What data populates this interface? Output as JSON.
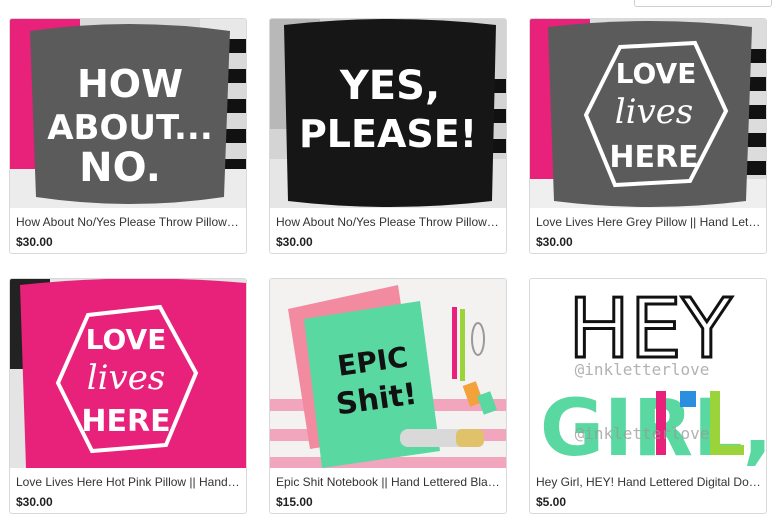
{
  "products": [
    {
      "title": "How About No/Yes Please Throw Pillow || Hand Lettered",
      "price": "$30.00",
      "art_text": [
        "HOW",
        "ABOUT...",
        "NO."
      ]
    },
    {
      "title": "How About No/Yes Please Throw Pillow || Hand Lettered",
      "price": "$30.00",
      "art_text": [
        "YES,",
        "PLEASE!"
      ]
    },
    {
      "title": "Love Lives Here Grey Pillow || Hand Lettered",
      "price": "$30.00",
      "art_text": [
        "LOVE",
        "lives",
        "HERE"
      ]
    },
    {
      "title": "Love Lives Here Hot Pink Pillow || Hand Lettered",
      "price": "$30.00",
      "art_text": [
        "LOVE",
        "lives",
        "HERE"
      ]
    },
    {
      "title": "Epic Shit Notebook || Hand Lettered Blank Journal",
      "price": "$15.00",
      "art_text": [
        "EPIC",
        "Shit!"
      ]
    },
    {
      "title": "Hey Girl, HEY! Hand Lettered Digital Download",
      "price": "$5.00",
      "art_text": [
        "HEY",
        "GIRL,"
      ],
      "watermark": "@inkletterlove"
    }
  ],
  "colors": {
    "accent_pink": "#e8217a",
    "pillow_grey": "#5b5b5b",
    "pillow_black": "#161616",
    "notebook_mint": "#59d8a1"
  }
}
